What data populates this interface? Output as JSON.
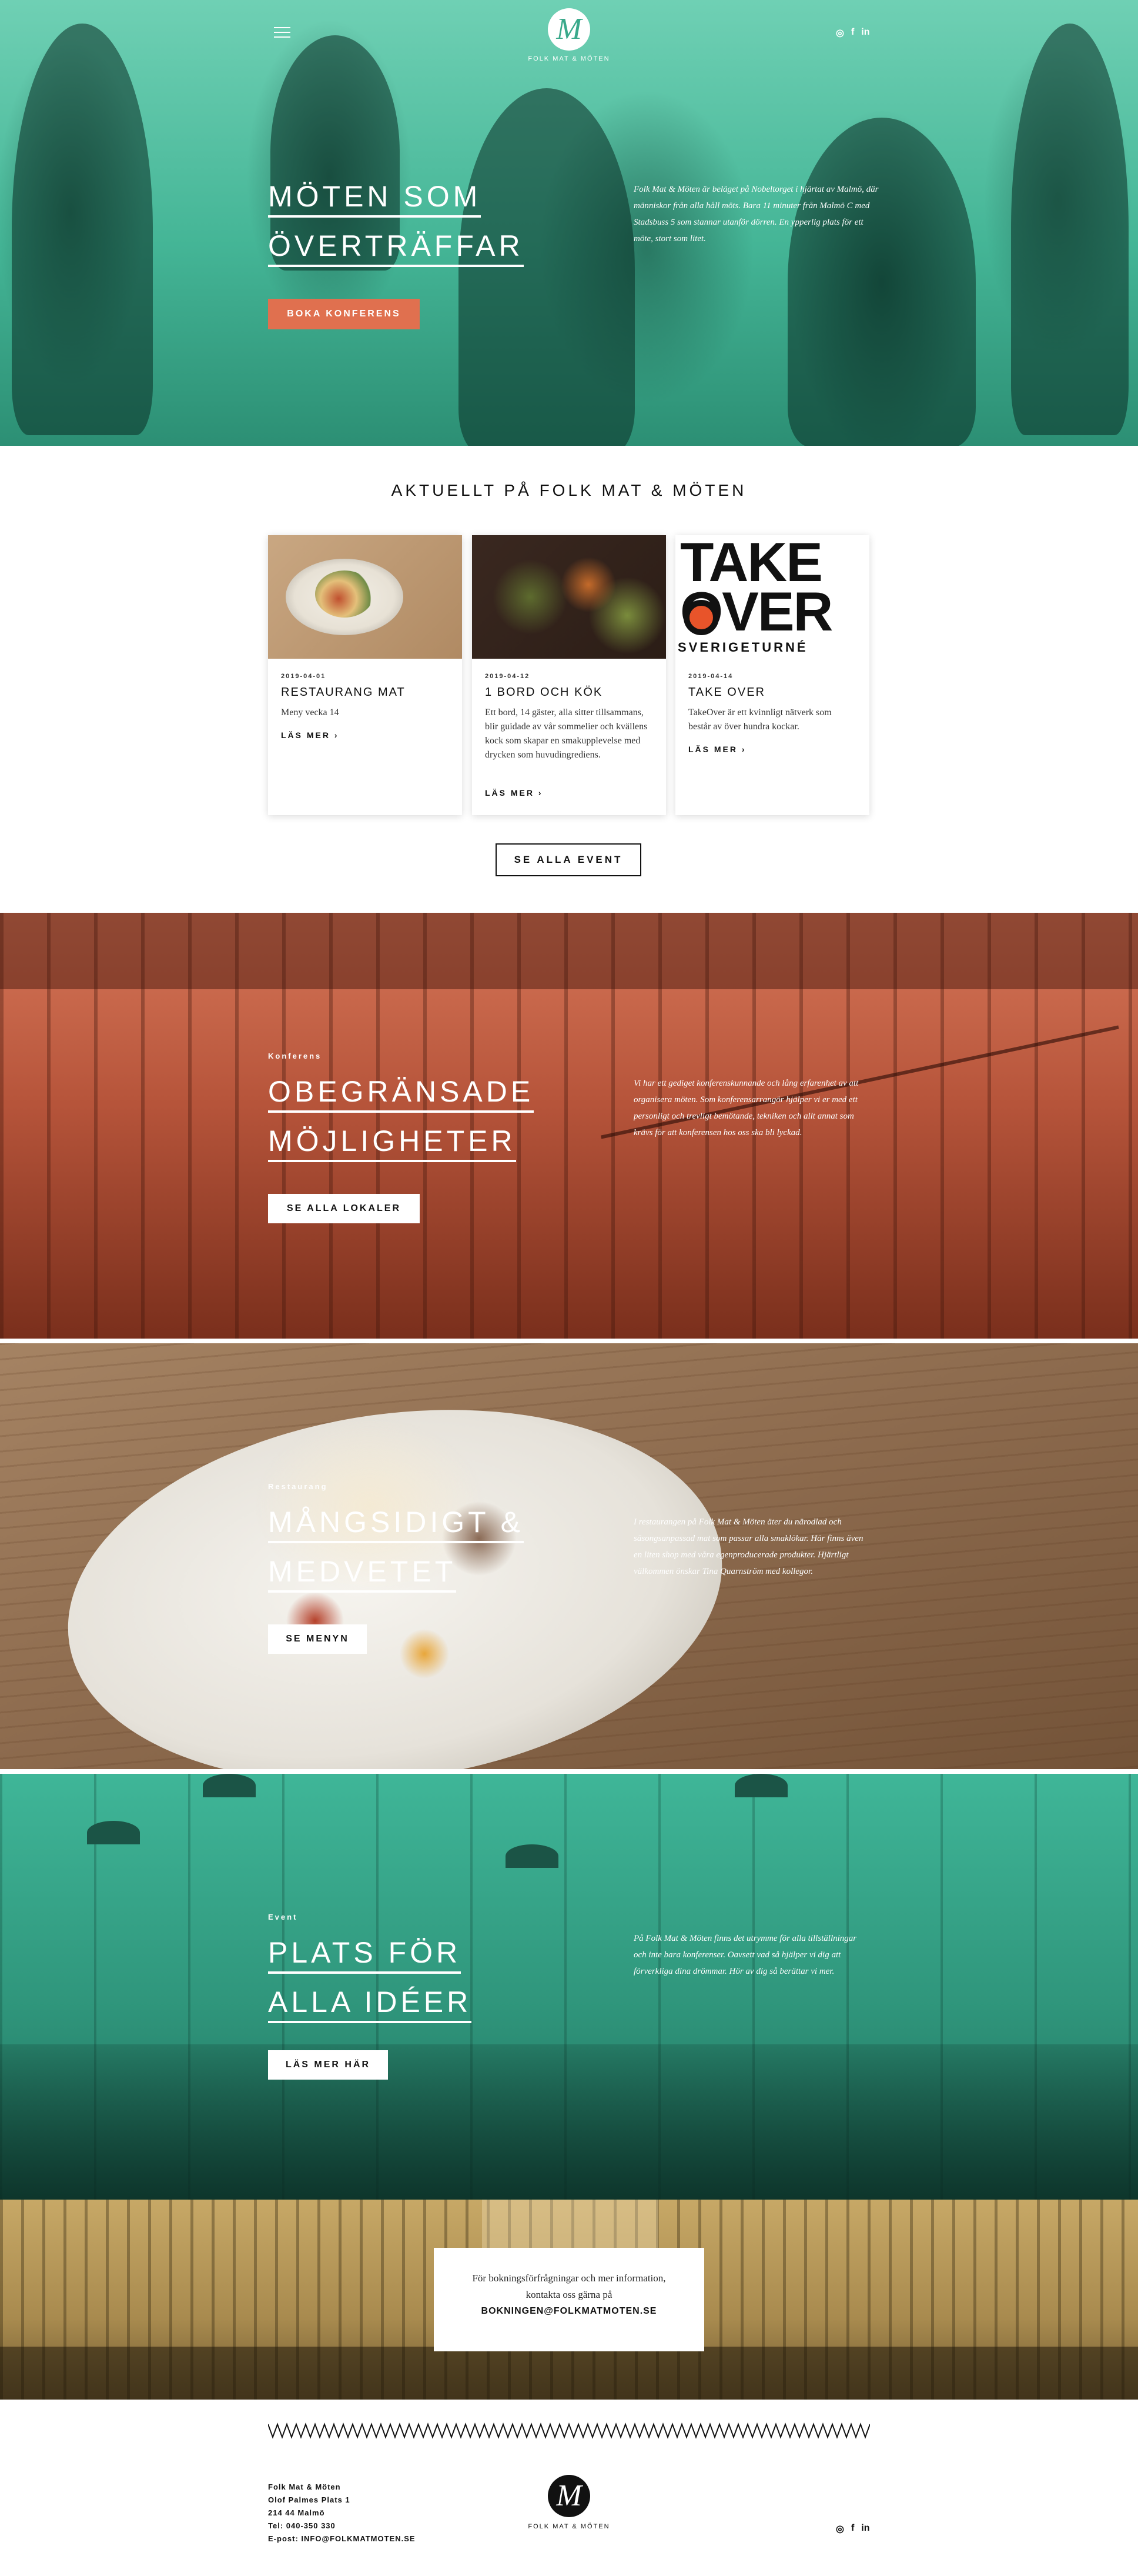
{
  "header": {
    "logo_text": "FOLK MAT & MÖTEN",
    "social": [
      "instagram-icon",
      "facebook-icon",
      "linkedin-icon"
    ],
    "social_glyphs": [
      "◎",
      "f",
      "in"
    ]
  },
  "hero": {
    "title_line1": "MÖTEN SOM",
    "title_line2": "ÖVERTRÄFFAR",
    "description": "Folk Mat & Möten är beläget på Nobeltorget i hjärtat av Malmö, där människor från alla håll möts. Bara 11 minuter från Malmö C med Stadsbuss 5 som stannar utanför dörren. En ypperlig plats för ett möte, stort som litet.",
    "button": "BOKA KONFERENS"
  },
  "news": {
    "heading": "AKTUELLT PÅ FOLK MAT & MÖTEN",
    "read_more": "LÄS MER ›",
    "cards": [
      {
        "date": "2019-04-01",
        "title": "RESTAURANG MAT",
        "text": "Meny vecka 14"
      },
      {
        "date": "2019-04-12",
        "title": "1 BORD OCH KÖK",
        "text": "Ett bord, 14 gäster, alla sitter tillsammans, blir guidade av vår sommelier och kvällens kock som skapar en smakupplevelse med drycken som huvudingrediens."
      },
      {
        "date": "2019-04-14",
        "title": "TAKE OVER",
        "text": "TakeOver är ett kvinnligt nätverk som består av över hundra kockar.",
        "poster_line1": "TAKE",
        "poster_line2": "OVER",
        "poster_line3": "SVERIGETURNÉ"
      }
    ],
    "see_all": "SE ALLA EVENT"
  },
  "konferens": {
    "label": "Konferens",
    "title_line1": "OBEGRÄNSADE",
    "title_line2": "MÖJLIGHETER",
    "description": "Vi har ett gediget konferenskunnande och lång erfarenhet av att organisera möten. Som konferensarrangör hjälper vi er med ett personligt och trevligt bemötande, tekniken och allt annat som krävs för att konferensen hos oss ska bli lyckad.",
    "button": "SE ALLA LOKALER"
  },
  "restaurang": {
    "label": "Restaurang",
    "title_line1": "MÅNGSIDIGT &",
    "title_line2": "MEDVETET",
    "description": "I restaurangen på Folk Mat & Möten äter du närodlad och säsongsanpassad mat som passar alla smaklökar. Här finns även en liten shop med våra egenproducerade produkter. Hjärtligt välkommen önskar Tina Quarnström med kollegor.",
    "button": "SE MENYN"
  },
  "event": {
    "label": "Event",
    "title_line1": "PLATS FÖR",
    "title_line2": "ALLA IDÉER",
    "description": "På Folk Mat & Möten finns det utrymme för alla tillställningar och inte bara konferenser. Oavsett vad så hjälper vi dig att förverkliga dina drömmar. Hör av dig så berättar vi mer.",
    "button": "LÄS MER HÄR"
  },
  "contact": {
    "text": "För bokningsförfrågningar och mer information, kontakta oss gärna på",
    "email": "BOKNINGEN@FOLKMATMOTEN.SE"
  },
  "footer": {
    "address": [
      "Folk Mat & Möten",
      "Olof Palmes Plats 1",
      "214 44 Malmö",
      "Tel: 040-350 330",
      "E-post: INFO@FOLKMATMOTEN.SE"
    ],
    "logo_text": "FOLK MAT & MÖTEN"
  },
  "colors": {
    "teal": "#44b596",
    "coral": "#e0704f",
    "rust": "#b6543a",
    "wood": "#8c6a4d",
    "gold": "#a88a4e"
  }
}
